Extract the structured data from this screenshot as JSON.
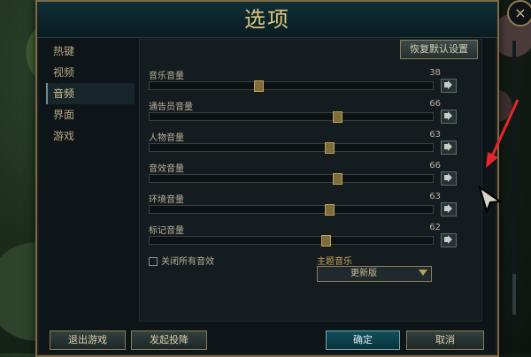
{
  "dialog": {
    "title": "选项",
    "close_symbol": "×"
  },
  "sidebar": {
    "items": [
      {
        "label": "热键"
      },
      {
        "label": "视频"
      },
      {
        "label": "音频"
      },
      {
        "label": "界面"
      },
      {
        "label": "游戏"
      }
    ]
  },
  "audio": {
    "restore_label": "恢复默认设置",
    "sliders": [
      {
        "label": "音乐音量",
        "value": 38
      },
      {
        "label": "通告员音量",
        "value": 66
      },
      {
        "label": "人物音量",
        "value": 63
      },
      {
        "label": "音效音量",
        "value": 66
      },
      {
        "label": "环境音量",
        "value": 63
      },
      {
        "label": "标记音量",
        "value": 62
      }
    ],
    "disable_all_label": "关闭所有音效",
    "theme_label": "主题音乐",
    "theme_value": "更新版"
  },
  "footer": {
    "exit_label": "退出游戏",
    "surrender_label": "发起投降",
    "ok_label": "确定",
    "cancel_label": "取消"
  },
  "colors": {
    "accent": "#c7a85d",
    "arrow": "#e6262b"
  }
}
